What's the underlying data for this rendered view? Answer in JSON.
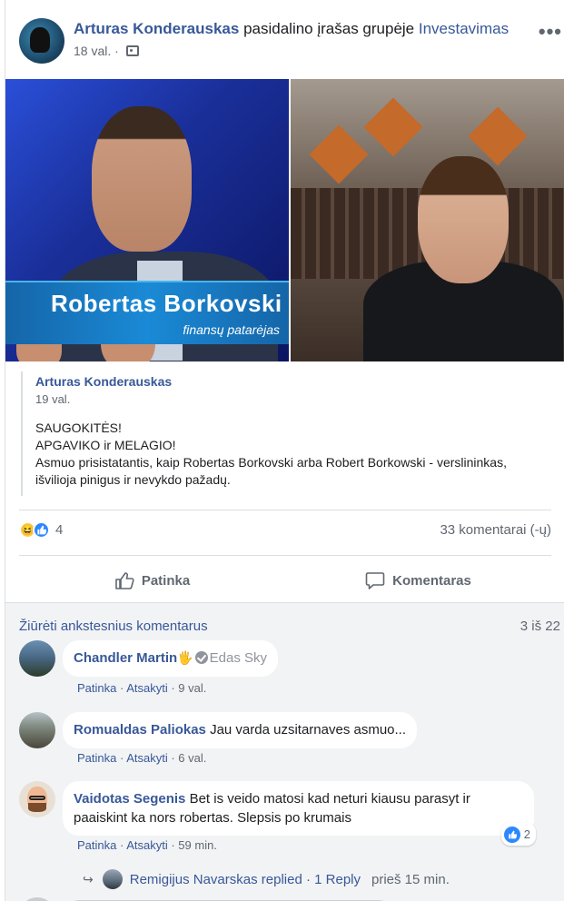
{
  "header": {
    "author": "Arturas Konderauskas",
    "action_text": "pasidalino įrašas grupėje",
    "group": "Investavimas",
    "time": "18 val.",
    "more_icon": "more-dots-icon"
  },
  "photos": {
    "left_lower_third_name": "Robertas Borkovski",
    "left_lower_third_title": "finansų patarėjas"
  },
  "shared_post": {
    "author": "Arturas Konderauskas",
    "time": "19 val.",
    "lines": [
      "SAUGOKITĖS!",
      "APGAVIKO ir MELAGIO!",
      "Asmuo prisistatantis, kaip Robertas Borkovski arba Robert Borkowski - verslininkas,",
      "išvilioja pinigus ir nevykdo pažadų."
    ]
  },
  "reactions": {
    "count": "4",
    "comments_count": "33 komentarai (-ų)",
    "icons": [
      "haha-icon",
      "like-icon"
    ]
  },
  "actions": {
    "like_label": "Patinka",
    "comment_label": "Komentaras"
  },
  "comments_section": {
    "view_previous": "Žiūrėti ankstesnius komentarus",
    "page_count": "3 iš 22",
    "comments": [
      {
        "author": "Chandler Martin",
        "badge": "Edas Sky",
        "text": "",
        "like": "Patinka",
        "reply": "Atsakyti",
        "time": "9 val."
      },
      {
        "author": "Romualdas Paliokas",
        "text": "Jau varda uzsitarnaves asmuo...",
        "like": "Patinka",
        "reply": "Atsakyti",
        "time": "6 val."
      },
      {
        "author": "Vaidotas Segenis",
        "text_line1": "Bet is veido matosi kad neturi kiausu parasyt ir",
        "text_line2": "paaiskint ka nors robertas. Slepsis po krumais",
        "reactions": "2",
        "like": "Patinka",
        "reply": "Atsakyti",
        "time": "59 min."
      }
    ],
    "reply": {
      "text": "Remigijus Navarskas replied · 1 Reply",
      "time": "prieš 15 min."
    }
  },
  "colors": {
    "link": "#385898",
    "meta": "#606770",
    "like_blue": "#2d88ff",
    "comments_bg": "#f2f3f5"
  }
}
